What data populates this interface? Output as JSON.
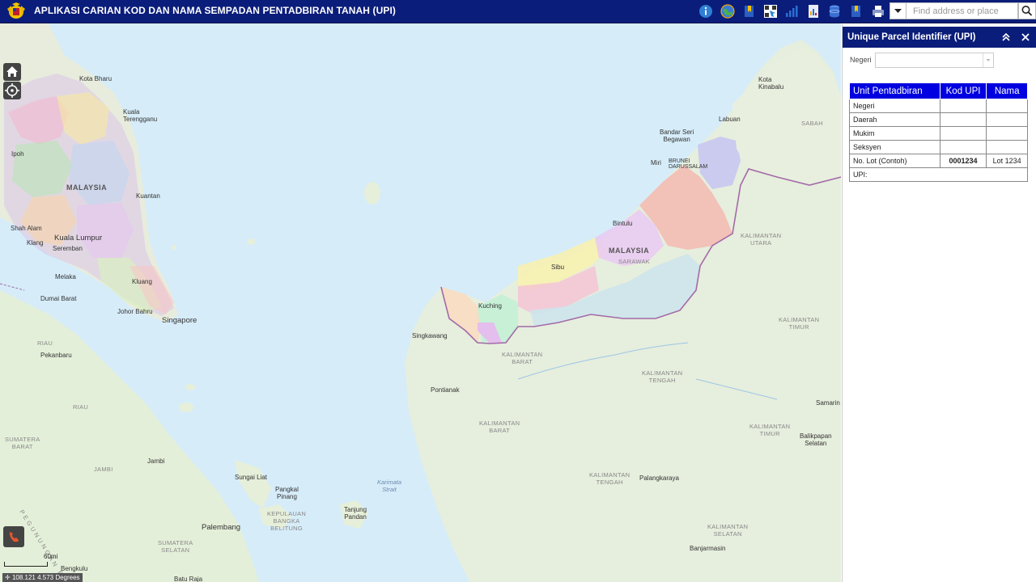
{
  "app": {
    "title": "APLIKASI CARIAN KOD DAN NAMA SEMPADAN PENTADBIRAN TANAH (UPI)"
  },
  "toolbar": {
    "icons": [
      "info-icon",
      "globe-icon",
      "bookmark-icon",
      "qr-map-icon",
      "bar-chart-icon",
      "document-chart-icon",
      "database-icon",
      "bookmark-icon",
      "print-icon"
    ]
  },
  "search": {
    "placeholder": "Find address or place"
  },
  "map": {
    "scale_label": "60mi",
    "coordinates": "108.121 4.573 Degrees",
    "labels": {
      "kota_bharu": "Kota Bharu",
      "kuala_terengganu": "Kuala\nTerengganu",
      "ipoh": "Ipoh",
      "malaysia_w": "MALAYSIA",
      "kuantan": "Kuantan",
      "shah_alam": "Shah Alam",
      "klang": "Klang",
      "kuala_lumpur": "Kuala Lumpur",
      "seremban": "Seremban",
      "melaka": "Melaka",
      "kluang": "Kluang",
      "dumai_barat": "Dumai Barat",
      "johor_bahru": "Johor Bahru",
      "singapore": "Singapore",
      "riau": "RIAU",
      "pekanbaru": "Pekanbaru",
      "riau2": "RIAU",
      "sumatera_barat": "SUMATERA\nBARAT",
      "jambi1": "JAMBI",
      "jambi2": "Jambi",
      "sungai_liat": "Sungai Liat",
      "pangkal_pinang": "Pangkal\nPinang",
      "kepulauan": "KEPULAUAN\nBANGKA\nBELITUNG",
      "tanjung_pandan": "Tanjung\nPandan",
      "karimata": "Karimata\nStrait",
      "palembang": "Palembang",
      "sumatera_selatan": "SUMATERA\nSELATAN",
      "bengkulu": "Bengkulu",
      "batu_raja": "Batu Raja",
      "kota_kinabalu": "Kota\nKinabalu",
      "labuan": "Labuan",
      "sabah": "SABAH",
      "bandar_seri_begawan": "Bandar Seri\nBegawan",
      "brunei": "BRUNEI\nDARUSSALAM",
      "miri": "Miri",
      "bintulu": "Bintulu",
      "malaysia_e": "MALAYSIA",
      "sarawak": "SARAWAK",
      "sibu": "Sibu",
      "kuching": "Kuching",
      "singkawang": "Singkawang",
      "kalbar1": "KALIMANTAN\nBARAT",
      "kalut": "KALIMANTAN\nUTARA",
      "kaltim1": "KALIMANTAN\nTIMUR",
      "kalteng1": "KALIMANTAN\nTENGAH",
      "pontianak": "Pontianak",
      "kalbar2": "KALIMANTAN\nBARAT",
      "samarinda": "Samarin",
      "kaltim2": "KALIMANTAN\nTIMUR",
      "balikpapan": "Balikpapan\nSelatan",
      "kalteng2": "KALIMANTAN\nTENGAH",
      "palangkaraya": "Palangkaraya",
      "kalsel": "KALIMANTAN\nSELATAN",
      "banjarmasin": "Banjarmasin",
      "pegunungan": "PEGUNUNGAN BARISAN"
    }
  },
  "panel": {
    "title": "Unique Parcel Identifier (UPI)",
    "negeri_label": "Negeri",
    "negeri_value": "",
    "table": {
      "headers": [
        "Unit Pentadbiran",
        "Kod UPI",
        "Nama"
      ],
      "rows": [
        [
          "Negeri",
          "",
          ""
        ],
        [
          "Daerah",
          "",
          ""
        ],
        [
          "Mukim",
          "",
          ""
        ],
        [
          "Seksyen",
          "",
          ""
        ],
        [
          "No. Lot (Contoh)",
          "0001234",
          "Lot 1234"
        ]
      ],
      "upi_label": "UPI:"
    }
  }
}
